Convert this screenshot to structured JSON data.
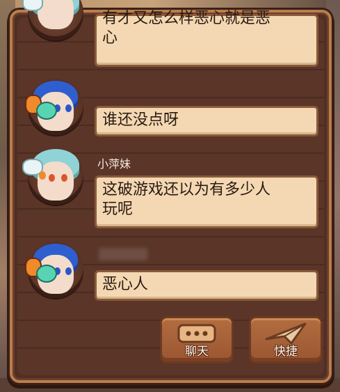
{
  "chat": {
    "messages": [
      {
        "sender": "",
        "avatar": "teal-hair-girl-avatar",
        "lines": [
          "有才又怎么样恶心就是恶",
          "心"
        ]
      },
      {
        "sender": "",
        "avatar": "blue-hair-cat-avatar",
        "lines": [
          "谁还没点呀"
        ]
      },
      {
        "sender": "小萍妹",
        "avatar": "teal-hair-girl-avatar",
        "lines": [
          "这破游戏还以为有多少人",
          "玩呢"
        ]
      },
      {
        "sender": "",
        "avatar": "blue-hair-cat-avatar",
        "lines": [
          "恶心人"
        ]
      }
    ]
  },
  "buttons": {
    "chat_label": "聊天",
    "quick_label": "快捷",
    "chat_icon": "ellipsis-bubble-icon",
    "quick_icon": "paper-plane-icon"
  }
}
